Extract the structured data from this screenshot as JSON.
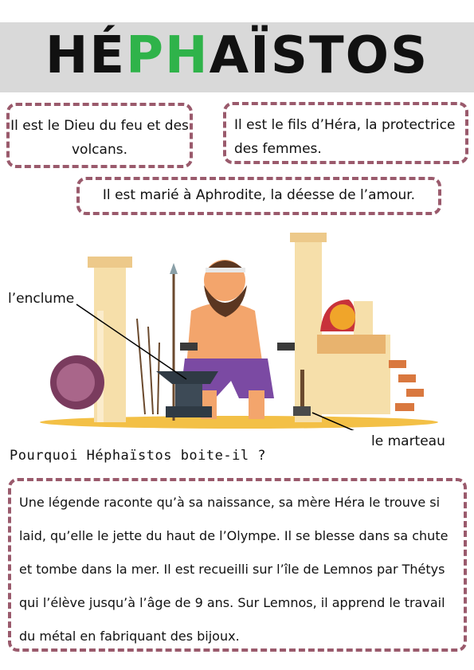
{
  "title": {
    "part1": "HÉ",
    "part2": "PH",
    "part3": "AÏSTOS"
  },
  "facts": {
    "god": "Il est le Dieu du feu et des volcans.",
    "son": "Il est le fils d’Héra, la protectrice des femmes.",
    "married": "Il est marié à Aphrodite, la déesse de l’amour."
  },
  "labels": {
    "anvil": "l’enclume",
    "hammer": "le marteau"
  },
  "question": "Pourquoi Héphaïstos boite-il ?",
  "story": "Une légende raconte qu’à sa naissance, sa mère Héra le trouve si laid, qu’elle le jette du haut de l’Olympe. Il se blesse dans sa chute et tombe dans la mer. Il est recueilli sur l’île de Lemnos par Thétys qui l’élève jusqu’à l’âge de 9 ans.  Sur Lemnos, il apprend le travail du métal en fabriquant des bijoux.",
  "colors": {
    "accent": "#2fb34a",
    "box_border": "#9a5a6c",
    "band": "#d9d9d9"
  }
}
